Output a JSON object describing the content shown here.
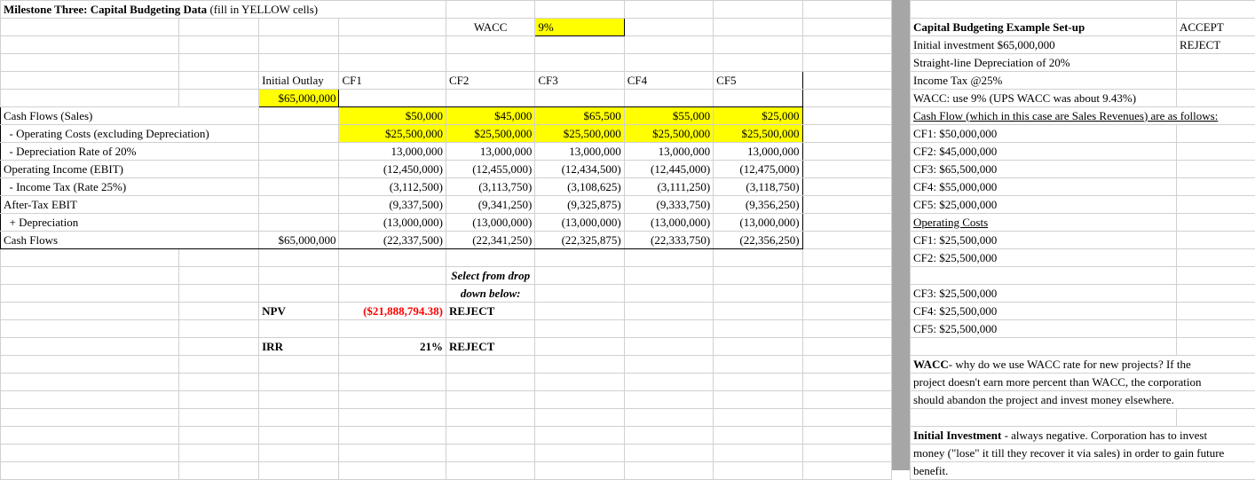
{
  "title_a": "Milestone Three: Capital Budgeting Data ",
  "title_b": "(fill in YELLOW cells)",
  "wacc_label": "WACC",
  "wacc_value": "9%",
  "hdr": {
    "io": "Initial Outlay",
    "cf1": "CF1",
    "cf2": "CF2",
    "cf3": "CF3",
    "cf4": "CF4",
    "cf5": "CF5"
  },
  "io_val": "$65,000,000",
  "rows": {
    "sales": {
      "label": "Cash Flows (Sales)",
      "v": [
        "$50,000",
        "$45,000",
        "$65,500",
        "$55,000",
        "$25,000"
      ]
    },
    "opcost": {
      "label": "  - Operating Costs (excluding Depreciation)",
      "v": [
        "$25,500,000",
        "$25,500,000",
        "$25,500,000",
        "$25,500,000",
        "$25,500,000"
      ]
    },
    "dep": {
      "label": "  - Depreciation Rate of 20%",
      "v": [
        "13,000,000",
        "13,000,000",
        "13,000,000",
        "13,000,000",
        "13,000,000"
      ]
    },
    "ebit": {
      "label": "Operating Income (EBIT)",
      "v": [
        "(12,450,000)",
        "(12,455,000)",
        "(12,434,500)",
        "(12,445,000)",
        "(12,475,000)"
      ]
    },
    "tax": {
      "label": "  - Income Tax (Rate 25%)",
      "v": [
        "(3,112,500)",
        "(3,113,750)",
        "(3,108,625)",
        "(3,111,250)",
        "(3,118,750)"
      ]
    },
    "atebit": {
      "label": "After-Tax EBIT",
      "v": [
        "(9,337,500)",
        "(9,341,250)",
        "(9,325,875)",
        "(9,333,750)",
        "(9,356,250)"
      ]
    },
    "adddep": {
      "label": "  + Depreciation",
      "v": [
        "(13,000,000)",
        "(13,000,000)",
        "(13,000,000)",
        "(13,000,000)",
        "(13,000,000)"
      ]
    },
    "cfrow": {
      "label": "Cash Flows",
      "io": "$65,000,000",
      "v": [
        "(22,337,500)",
        "(22,341,250)",
        "(22,325,875)",
        "(22,333,750)",
        "(22,356,250)"
      ]
    }
  },
  "select_note_a": "Select from drop",
  "select_note_b": "down below:",
  "npv": {
    "label": "NPV",
    "value": "($21,888,794.38)",
    "decision": "REJECT"
  },
  "irr": {
    "label": "IRR",
    "value": "21%",
    "decision": "REJECT"
  },
  "right": {
    "title": "Capital Budgeting Example Set-up",
    "accept": "ACCEPT",
    "reject": "REJECT",
    "lines": [
      "Initial investment $65,000,000",
      "Straight-line Depreciation of 20%",
      "Income Tax @25%",
      "WACC: use 9% (UPS WACC was about 9.43%)"
    ],
    "cash_flow_hdr": "Cash Flow (which in this case are Sales Revenues) are as follows:",
    "cfs": [
      "CF1: $50,000,000",
      "CF2: $45,000,000",
      "CF3: $65,500,000",
      "CF4: $55,000,000",
      "CF5: $25,000,000"
    ],
    "oc_hdr": "Operating Costs",
    "ocs": [
      "CF1: $25,500,000",
      "CF2: $25,500,000",
      "",
      "CF3: $25,500,000",
      "CF4: $25,500,000",
      "CF5: $25,500,000"
    ],
    "wacc_b": "WACC",
    "wacc_txt": "- why do we use WACC rate for new projects? If the",
    "wacc_txt2": "project doesn't earn more percent than WACC, the corporation",
    "wacc_txt3": "should abandon the project and invest money elsewhere.",
    "ii_b": "Initial Investment",
    "ii_txt1": " - always negative. Corporation has to invest",
    "ii_txt2": "money (\"lose\" it till they recover it via sales) in order to gain future",
    "ii_txt3": "benefit."
  }
}
